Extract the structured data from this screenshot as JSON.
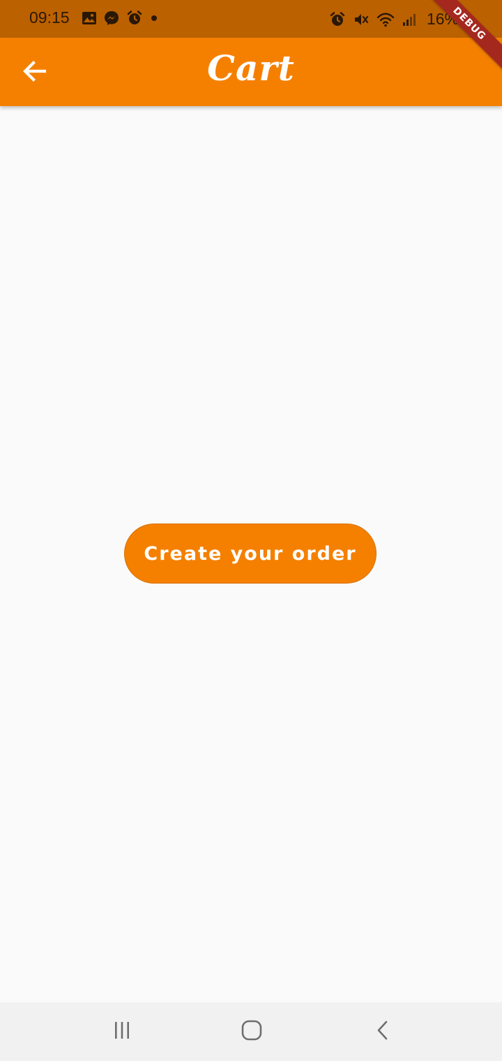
{
  "status_bar": {
    "time": "09:15",
    "battery": "16%",
    "left_icons": [
      "gallery-icon",
      "messenger-icon",
      "alarm-icon",
      "dot-icon"
    ],
    "right_icons": [
      "alarm-icon",
      "mute-icon",
      "wifi-icon",
      "signal-icon"
    ],
    "background": "#bc6100"
  },
  "app_bar": {
    "title": "Cart",
    "back_icon": "arrow-left-icon",
    "background": "#f58000"
  },
  "debug_banner": {
    "label": "DEBUG",
    "color": "#a5281f"
  },
  "main": {
    "create_order_label": "Create your order",
    "accent": "#f58000"
  },
  "nav_bar": {
    "items": [
      "recents-icon",
      "home-icon",
      "back-icon"
    ]
  }
}
